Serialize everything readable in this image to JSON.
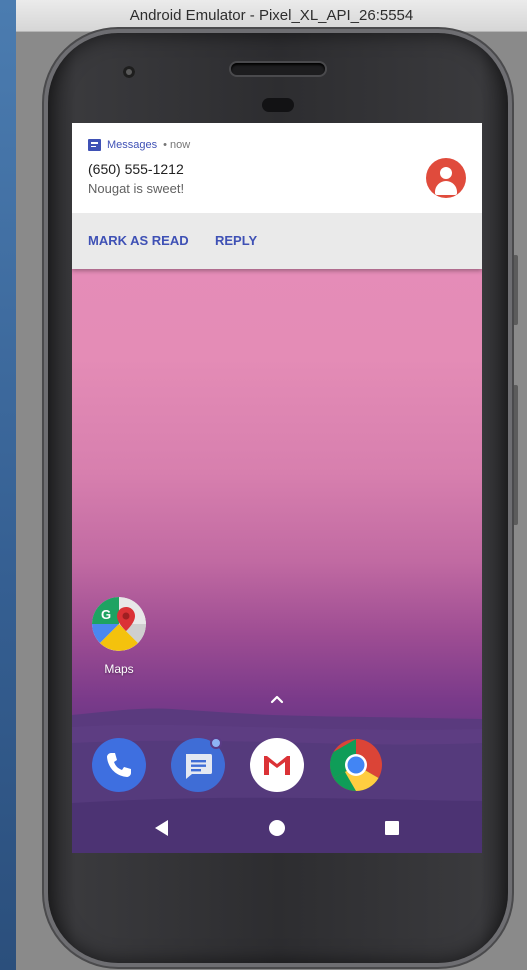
{
  "window": {
    "title": "Android Emulator - Pixel_XL_API_26:5554"
  },
  "notification": {
    "app_name": "Messages",
    "time": "• now",
    "sender": "(650) 555-1212",
    "message": "Nougat is sweet!",
    "actions": {
      "mark_as_read": "MARK AS READ",
      "reply": "REPLY"
    },
    "avatar_color": "#e04b3c",
    "accent_color": "#3f51b5"
  },
  "home": {
    "apps": [
      {
        "label": "Maps",
        "icon": "maps-icon"
      }
    ],
    "dock": [
      {
        "name": "Phone",
        "icon": "phone-icon"
      },
      {
        "name": "Messages",
        "icon": "messages-icon",
        "has_badge": true
      },
      {
        "name": "Gmail",
        "icon": "gmail-icon"
      },
      {
        "name": "Chrome",
        "icon": "chrome-icon"
      }
    ]
  },
  "navigation": {
    "buttons": [
      "back-icon",
      "home-icon",
      "recent-apps-icon"
    ]
  }
}
